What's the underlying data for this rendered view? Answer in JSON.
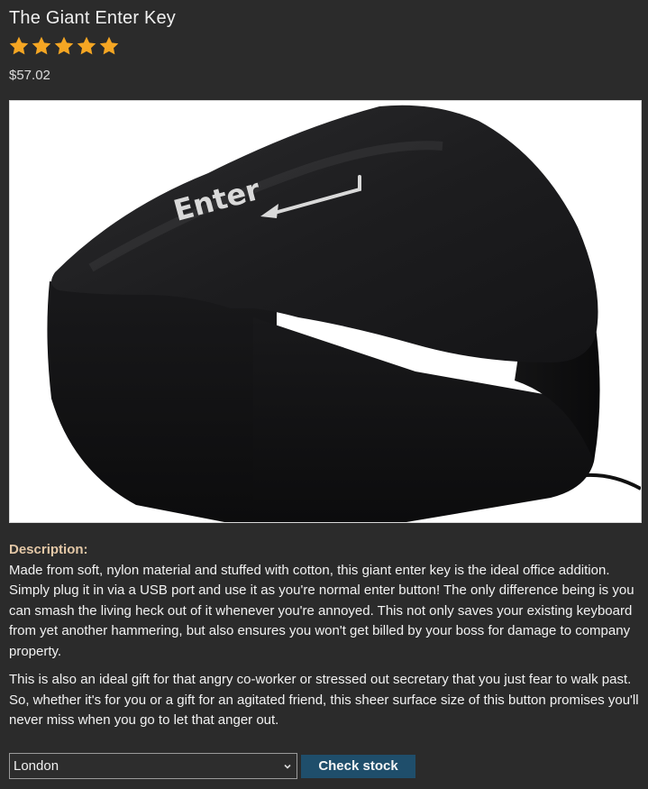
{
  "product": {
    "title": "The Giant Enter Key",
    "rating": 5,
    "rating_max": 5,
    "star_color": "#f5a623",
    "price": "$57.02",
    "image_key_label": "Enter"
  },
  "description": {
    "heading": "Description:",
    "paragraphs": [
      "Made from soft, nylon material and stuffed with cotton, this giant enter key is the ideal office addition. Simply plug it in via a USB port and use it as you're normal enter button! The only difference being is you can smash the living heck out of it whenever you're annoyed. This not only saves your existing keyboard from yet another hammering, but also ensures you won't get billed by your boss for damage to company property.",
      "This is also an ideal gift for that angry co-worker or stressed out secretary that you just fear to walk past. So, whether it's for you or a gift for an agitated friend, this sheer surface size of this button promises you'll never miss when you go to let that anger out."
    ]
  },
  "stock_check": {
    "selected_location": "London",
    "button_label": "Check stock",
    "button_color": "#1f4e6b"
  }
}
